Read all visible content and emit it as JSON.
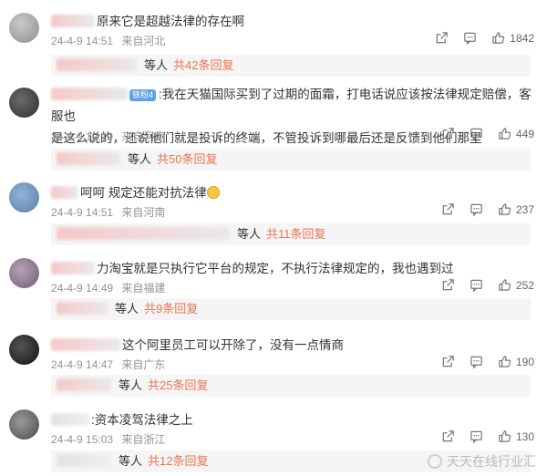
{
  "comments": [
    {
      "text": "原来它是超越法律的存在啊",
      "date": "24-4-9 14:51",
      "location": "来自河北",
      "likes": "1842",
      "reply_who": "等人",
      "reply_total": "共42条回复"
    },
    {
      "badge": "铁粉4",
      "text": ":我在天猫国际买到了过期的面霜，打电话说应该按法律规定赔偿，客服也",
      "text2": "是这么说的，还说他们就是投诉的终端，不管投诉到哪最后还是反馈到他们那里",
      "date": "24-4-9 12:19",
      "location": "来自河南",
      "likes": "449",
      "reply_who": "等人",
      "reply_total": "共50条回复"
    },
    {
      "text": "呵呵 规定还能对抗法律",
      "date": "24-4-9 14:51",
      "location": "来自河南",
      "likes": "237",
      "reply_who": "等人",
      "reply_total": "共11条回复"
    },
    {
      "text": "力淘宝就是只执行它平台的规定，不执行法律规定的，我也遇到过",
      "date": "24-4-9 14:49",
      "location": "来自福建",
      "likes": "252",
      "reply_who": "等人",
      "reply_total": "共9条回复"
    },
    {
      "text": "这个阿里员工可以开除了，没有一点情商",
      "date": "24-4-9 14:47",
      "location": "来自广东",
      "likes": "190",
      "reply_who": "等人",
      "reply_total": "共25条回复"
    },
    {
      "text": ":资本凌驾法律之上",
      "date": "24-4-9 15:03",
      "location": "来自浙江",
      "likes": "130",
      "reply_who": "等人",
      "reply_total": "共12条回复"
    }
  ],
  "watermark": "天天在线行业汇",
  "colors": {
    "reply_accent": "#eb7350",
    "meta_gray": "#939393",
    "reply_bg": "#f5f5f5"
  },
  "icons": [
    "share-icon",
    "comment-icon",
    "like-icon"
  ]
}
